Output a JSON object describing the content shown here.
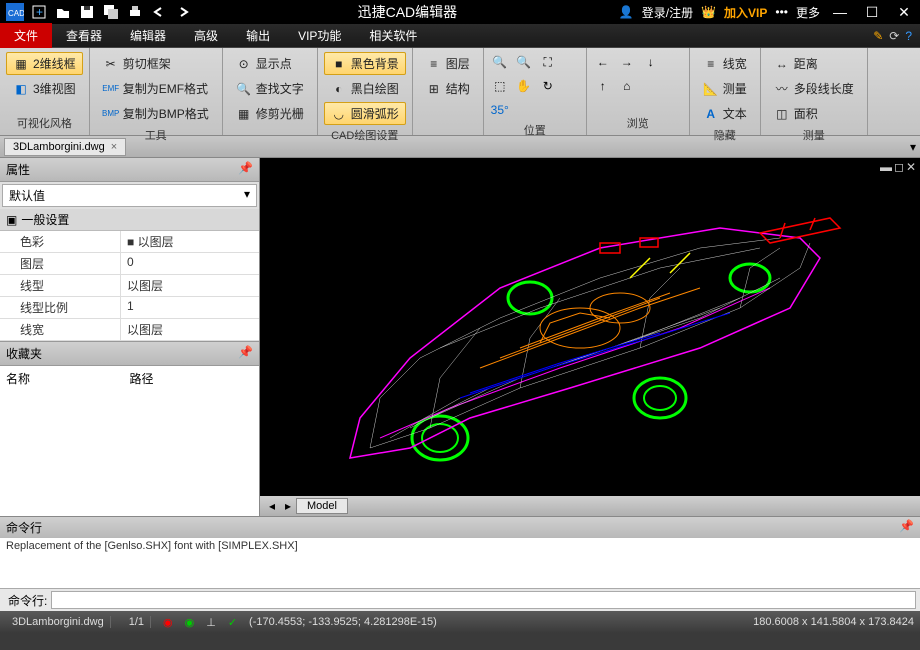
{
  "titlebar": {
    "app_title": "迅捷CAD编辑器",
    "login": "登录/注册",
    "vip": "加入VIP",
    "more": "更多"
  },
  "menu": {
    "tabs": [
      "文件",
      "查看器",
      "编辑器",
      "高级",
      "输出",
      "VIP功能",
      "相关软件"
    ],
    "active": 0
  },
  "ribbon": {
    "g1": {
      "label": "可视化风格",
      "items": [
        "2维线框",
        "3维视图"
      ]
    },
    "g2": {
      "label": "工具",
      "items": [
        "剪切框架",
        "复制为EMF格式",
        "复制为BMP格式"
      ]
    },
    "g3": {
      "items": [
        "显示点",
        "查找文字",
        "修剪光栅"
      ]
    },
    "g4": {
      "label": "CAD绘图设置",
      "items": [
        "黑色背景",
        "黑白绘图",
        "圆滑弧形"
      ]
    },
    "g5": {
      "items": [
        "图层",
        "结构"
      ]
    },
    "g6": {
      "label": "位置"
    },
    "g7": {
      "label": "浏览"
    },
    "g8": {
      "label": "隐藏",
      "items": [
        "线宽",
        "测量",
        "文本"
      ]
    },
    "g9": {
      "label": "测量",
      "items": [
        "距离",
        "多段线长度",
        "面积"
      ]
    }
  },
  "doc_tab": "3DLamborgini.dwg",
  "props": {
    "header": "属性",
    "default": "默认值",
    "section": "一般设置",
    "rows": [
      {
        "k": "色彩",
        "v": "■ 以图层"
      },
      {
        "k": "图层",
        "v": "0"
      },
      {
        "k": "线型",
        "v": "以图层"
      },
      {
        "k": "线型比例",
        "v": "1"
      },
      {
        "k": "线宽",
        "v": "以图层"
      }
    ]
  },
  "fav": {
    "header": "收藏夹",
    "col1": "名称",
    "col2": "路径"
  },
  "model_tab": "Model",
  "cmd": {
    "header": "命令行",
    "text": "Replacement of the [Genlso.SHX] font with [SIMPLEX.SHX]",
    "prompt": "命令行:"
  },
  "status": {
    "file": "3DLamborgini.dwg",
    "page": "1/1",
    "coords": "(-170.4553; -133.9525; 4.281298E-15)",
    "dims": "180.6008 x 141.5804 x 173.8424"
  }
}
